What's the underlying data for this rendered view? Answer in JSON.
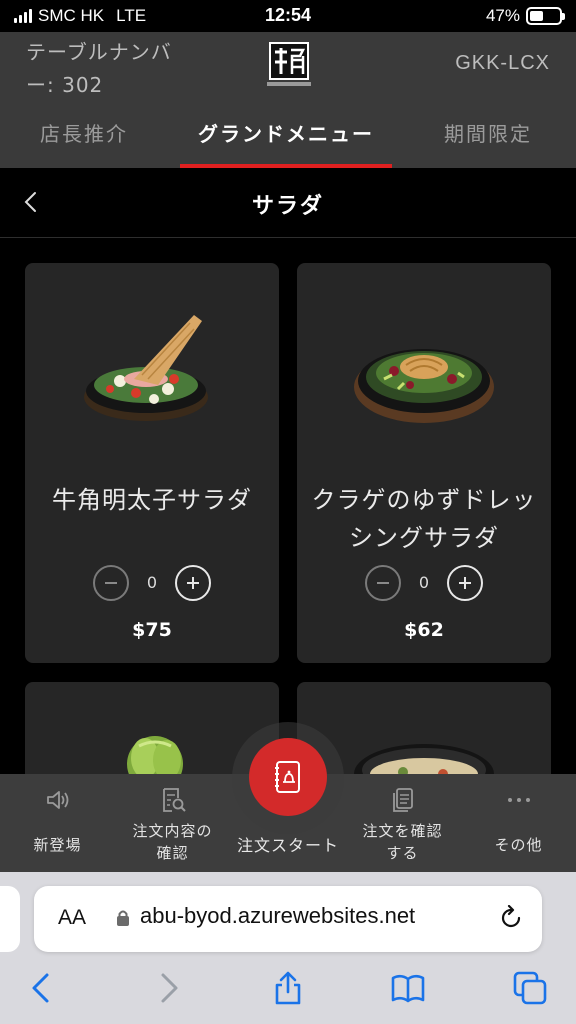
{
  "status_bar": {
    "carrier": "SMC HK",
    "network": "LTE",
    "time": "12:54",
    "battery": "47%",
    "battery_level": 0.47
  },
  "header": {
    "table_number": "テーブルナンバー: 302",
    "logo_icon": "gyukaku-logo",
    "store_code": "GKK-LCX"
  },
  "tabs": [
    {
      "label": "店長推介",
      "active": false
    },
    {
      "label": "グランドメニュー",
      "active": true
    },
    {
      "label": "期間限定",
      "active": false
    }
  ],
  "category": {
    "back_icon": "chevron-left-icon",
    "title": "サラダ"
  },
  "items": [
    {
      "name": "牛角明太子サラダ",
      "quantity": "0",
      "price": "$75",
      "image_icon": "mentaiko-salad-image"
    },
    {
      "name": "クラゲのゆずドレッシングサラダ",
      "quantity": "0",
      "price": "$62",
      "image_icon": "jellyfish-salad-image"
    },
    {
      "name": "",
      "quantity": "",
      "price": "",
      "image_icon": "lettuce-image"
    },
    {
      "name": "",
      "quantity": "",
      "price": "",
      "image_icon": "salad-bowl-image"
    }
  ],
  "bottom_nav": {
    "new": {
      "label": "新登場",
      "icon": "speaker-icon"
    },
    "order_review": {
      "label": "注文内容の確認",
      "icon": "document-search-icon"
    },
    "start_order": {
      "label": "注文スタート",
      "icon": "order-book-icon"
    },
    "confirm_order": {
      "label": "注文を確認する",
      "icon": "documents-icon"
    },
    "other": {
      "label": "その他",
      "icon": "more-dots-icon"
    }
  },
  "browser": {
    "text_size_label": "AA",
    "url": "abu-byod.azurewebsites.net",
    "colors": {
      "accent": "#d32a2a",
      "link_blue": "#1a73e8"
    }
  }
}
